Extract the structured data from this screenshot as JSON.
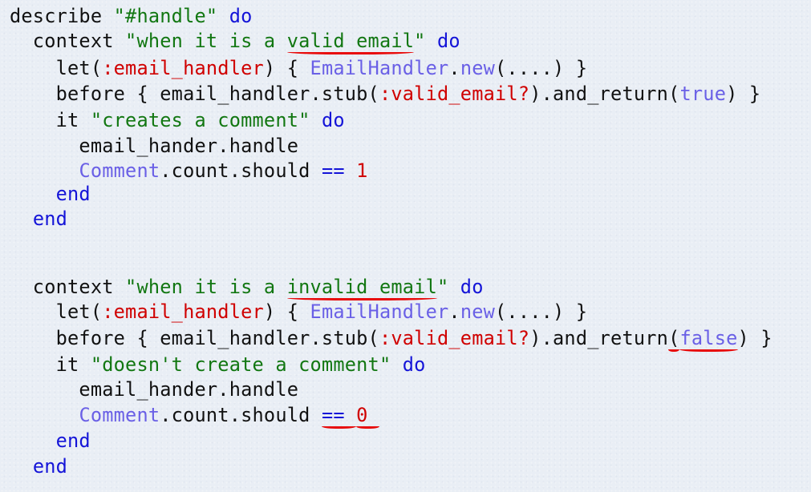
{
  "colors": {
    "keyword": "#1414d8",
    "string": "#127712",
    "symbol": "#d00000",
    "constant": "#6a60e6",
    "plain": "#111111",
    "highlight_underline": "#e80c0c"
  },
  "lines": [
    {
      "segments": [
        {
          "t": "plain",
          "v": "describe "
        },
        {
          "t": "string",
          "v": "\"#handle\""
        },
        {
          "t": "plain",
          "v": " "
        },
        {
          "t": "keyword",
          "v": "do"
        }
      ]
    },
    {
      "segments": [
        {
          "t": "plain",
          "v": "  context "
        },
        {
          "t": "string",
          "v": "\"when it is a "
        },
        {
          "t": "string",
          "v": "valid email",
          "marked": true
        },
        {
          "t": "string",
          "v": "\""
        },
        {
          "t": "plain",
          "v": " "
        },
        {
          "t": "keyword",
          "v": "do"
        }
      ]
    },
    {
      "segments": [
        {
          "t": "plain",
          "v": "    let("
        },
        {
          "t": "symbol",
          "v": ":email_handler"
        },
        {
          "t": "plain",
          "v": ") { "
        },
        {
          "t": "const",
          "v": "EmailHandler"
        },
        {
          "t": "plain",
          "v": "."
        },
        {
          "t": "const",
          "v": "new"
        },
        {
          "t": "plain",
          "v": "(....) }"
        }
      ]
    },
    {
      "segments": [
        {
          "t": "plain",
          "v": "    before { email_handler.stub("
        },
        {
          "t": "symbol",
          "v": ":valid_email?"
        },
        {
          "t": "plain",
          "v": ").and_return("
        },
        {
          "t": "const",
          "v": "true"
        },
        {
          "t": "plain",
          "v": ") }"
        }
      ]
    },
    {
      "segments": [
        {
          "t": "plain",
          "v": "    it "
        },
        {
          "t": "string",
          "v": "\"creates a comment\""
        },
        {
          "t": "plain",
          "v": " "
        },
        {
          "t": "keyword",
          "v": "do"
        }
      ]
    },
    {
      "segments": [
        {
          "t": "plain",
          "v": "      email_hander.handle"
        }
      ]
    },
    {
      "segments": [
        {
          "t": "plain",
          "v": "      "
        },
        {
          "t": "const",
          "v": "Comment"
        },
        {
          "t": "plain",
          "v": ".count.should "
        },
        {
          "t": "op",
          "v": "=="
        },
        {
          "t": "plain",
          "v": " "
        },
        {
          "t": "number",
          "v": "1"
        }
      ]
    },
    {
      "segments": [
        {
          "t": "plain",
          "v": "    "
        },
        {
          "t": "keyword",
          "v": "end"
        }
      ]
    },
    {
      "segments": [
        {
          "t": "plain",
          "v": "  "
        },
        {
          "t": "keyword",
          "v": "end"
        }
      ]
    },
    {
      "segments": [
        {
          "t": "plain",
          "v": "  context "
        },
        {
          "t": "string",
          "v": "\"when it is a "
        },
        {
          "t": "string",
          "v": "invalid email",
          "marked": true
        },
        {
          "t": "string",
          "v": "\""
        },
        {
          "t": "plain",
          "v": " "
        },
        {
          "t": "keyword",
          "v": "do"
        }
      ]
    },
    {
      "segments": [
        {
          "t": "plain",
          "v": "    let("
        },
        {
          "t": "symbol",
          "v": ":email_handler"
        },
        {
          "t": "plain",
          "v": ") { "
        },
        {
          "t": "const",
          "v": "EmailHandler"
        },
        {
          "t": "plain",
          "v": "."
        },
        {
          "t": "const",
          "v": "new"
        },
        {
          "t": "plain",
          "v": "(....) }"
        }
      ]
    },
    {
      "segments": [
        {
          "t": "plain",
          "v": "    before { email_handler.stub("
        },
        {
          "t": "symbol",
          "v": ":valid_email?"
        },
        {
          "t": "plain",
          "v": ").and_return"
        },
        {
          "t": "plain",
          "v": "(",
          "marked": true
        },
        {
          "t": "const",
          "v": "false",
          "marked": true
        },
        {
          "t": "plain",
          "v": ") }"
        }
      ]
    },
    {
      "segments": [
        {
          "t": "plain",
          "v": "    it "
        },
        {
          "t": "string",
          "v": "\"doesn't create a comment\""
        },
        {
          "t": "plain",
          "v": " "
        },
        {
          "t": "keyword",
          "v": "do"
        }
      ]
    },
    {
      "segments": [
        {
          "t": "plain",
          "v": "      email_hander.handle"
        }
      ]
    },
    {
      "segments": [
        {
          "t": "plain",
          "v": "      "
        },
        {
          "t": "const",
          "v": "Comment"
        },
        {
          "t": "plain",
          "v": ".count.should "
        },
        {
          "t": "op",
          "v": "== ",
          "marked": true
        },
        {
          "t": "number",
          "v": "0 ",
          "marked": true
        }
      ]
    },
    {
      "segments": [
        {
          "t": "plain",
          "v": "    "
        },
        {
          "t": "keyword",
          "v": "end"
        }
      ]
    },
    {
      "segments": [
        {
          "t": "plain",
          "v": "  "
        },
        {
          "t": "keyword",
          "v": "end"
        }
      ]
    }
  ]
}
